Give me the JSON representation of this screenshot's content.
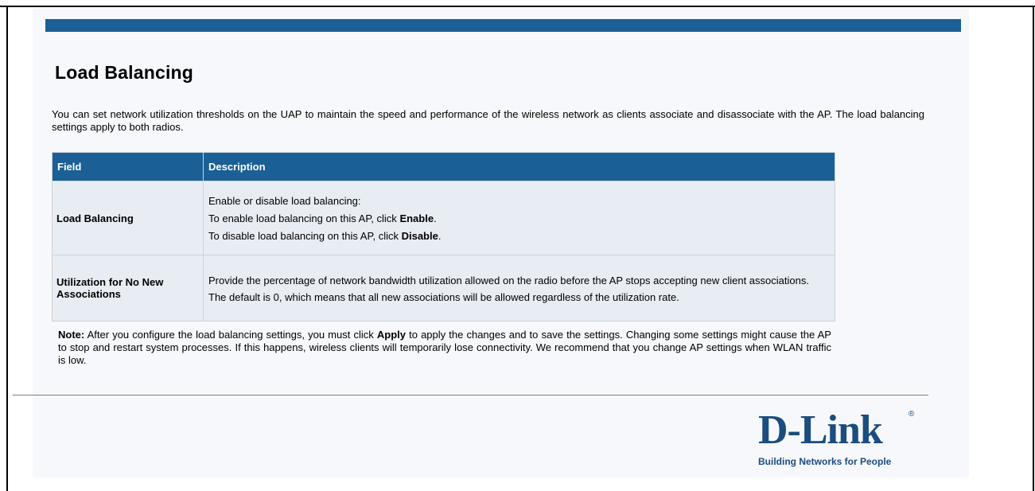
{
  "page": {
    "title": "Load Balancing",
    "intro": "You can set network utilization thresholds on the UAP to maintain the speed and performance of the wireless network as clients associate and disassociate with the AP. The load balancing settings apply to both radios."
  },
  "table": {
    "headers": [
      "Field",
      "Description"
    ],
    "rows": [
      {
        "field": "Load Balancing",
        "line1": "Enable or disable load balancing:",
        "line2_pre": "To enable load balancing on this AP, click ",
        "line2_bold": "Enable",
        "line2_post": ".",
        "line3_pre": "To disable load balancing on this AP, click ",
        "line3_bold": "Disable",
        "line3_post": "."
      },
      {
        "field": "Utilization for No New Associations",
        "line1": "Provide the percentage of network bandwidth utilization allowed on the radio before the AP stops accepting new client associations.",
        "line2": "The default is 0, which means that all new associations will be allowed regardless of the utilization rate."
      }
    ]
  },
  "note": {
    "label": "Note:",
    "pre": " After you configure the load balancing settings, you must click ",
    "bold": "Apply",
    "post": " to apply the changes and to save the settings. Changing some settings might cause the AP to stop and restart system processes. If this happens, wireless clients will temporarily lose connectivity. We recommend that you change AP settings when WLAN traffic is low."
  },
  "logo": {
    "brand": "D-Link",
    "registered": "®",
    "tagline": "Building Networks for People"
  },
  "colors": {
    "header_bar": "#1a5f95",
    "table_header": "#1a5f95",
    "table_cell": "#e8edf4",
    "brand": "#1b4d7e"
  }
}
